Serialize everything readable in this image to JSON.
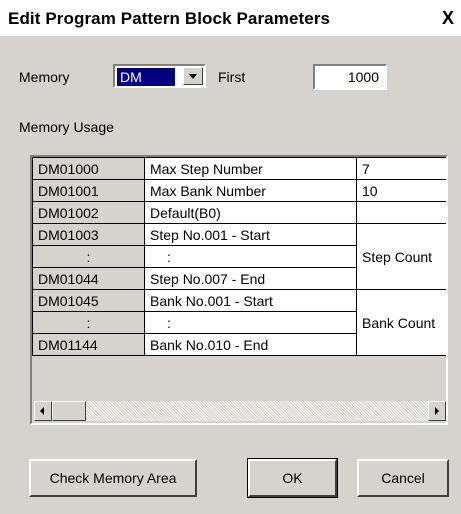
{
  "dialog": {
    "title": "Edit Program Pattern Block Parameters",
    "close_glyph": "X"
  },
  "memory": {
    "label": "Memory",
    "selected": "DM"
  },
  "first": {
    "label": "First",
    "value": "1000"
  },
  "usage": {
    "label": "Memory Usage",
    "rows": [
      {
        "addr": "DM01000",
        "desc": "Max Step Number",
        "val": "7"
      },
      {
        "addr": "DM01001",
        "desc": "Max Bank Number",
        "val": "10"
      },
      {
        "addr": "DM01002",
        "desc": "Default(B0)",
        "val": ""
      },
      {
        "addr": "DM01003",
        "desc": "Step No.001 - Start",
        "val": ""
      },
      {
        "addr": ":",
        "desc": "   :",
        "val": "Step Count"
      },
      {
        "addr": "DM01044",
        "desc": "Step No.007 - End",
        "val": ""
      },
      {
        "addr": "DM01045",
        "desc": "Bank No.001 - Start",
        "val": ""
      },
      {
        "addr": ":",
        "desc": "   :",
        "val": "Bank Count"
      },
      {
        "addr": "DM01144",
        "desc": "Bank No.010 - End",
        "val": ""
      }
    ]
  },
  "buttons": {
    "check_memory": "Check Memory Area",
    "ok": "OK",
    "cancel": "Cancel"
  }
}
